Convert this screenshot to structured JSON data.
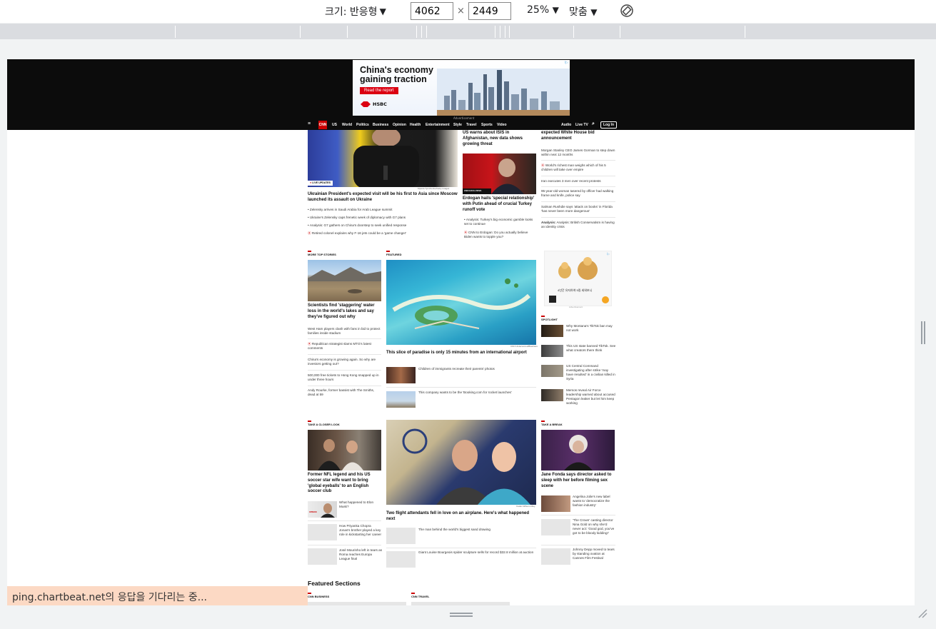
{
  "devtools": {
    "size_label": "크기: 반응형",
    "width_value": "4062",
    "height_value": "2449",
    "times": "×",
    "zoom": "25%",
    "fit": "맞춤",
    "dropdown_glyph": "▼"
  },
  "status": {
    "text": "ping.chartbeat.net의 응답을 기다리는 중..."
  },
  "ad": {
    "headline_1": "China's economy",
    "headline_2": "gaining traction",
    "button": "Read the report",
    "brand": "HSBC",
    "label": "Advertisement",
    "badge": "i▷"
  },
  "nav": {
    "logo": "CNN",
    "items": [
      "US",
      "World",
      "Politics",
      "Business",
      "Opinion",
      "Health",
      "Entertainment",
      "Style",
      "Travel",
      "Sports",
      "Video"
    ],
    "audio": "Audio",
    "live_tv": "Live TV",
    "login": "Log In"
  },
  "lead": {
    "live_badge": "LIVE UPDATES",
    "credit": "Mykola Tymchenko/Getty Images",
    "headline": "Ukrainian President's expected visit will be his first to Asia since Moscow launched its assault on Ukraine",
    "bullets": [
      "Zelensky arrives in Saudi Arabia for Arab League summit",
      "Ukraine's Zelensky caps frenetic week of diplomacy with G7 plans",
      "Analysis: G7 gathers on China's doorstep to seek unified response",
      "Retired colonel explains why F-16 jets could be a 'game changer'"
    ]
  },
  "middle": {
    "isis": "US warns about ISIS in Afghanistan, new data shows growing threat",
    "erdogan_badge": "CNN EXCLUSIVE",
    "erdogan": "Erdogan hails 'special relationship' with Putin ahead of crucial Turkey runoff vote",
    "bullets": [
      "Analysis: Turkey's big economic gamble looks set to continue",
      "CNN to Erdogan: Do you actually believe Biden wants to topple you?"
    ]
  },
  "right_top": {
    "head": "expected White House bid announcement",
    "items": [
      "Morgan Stanley CEO James Gorman to step down within next 12 months",
      "World's richest man weighs which of his 5 children will take over empire",
      "Iran executes 3 men over recent protests",
      "95-year-old woman tasered by officer had walking frame and knife, police say",
      "Salman Rushdie says 'attack on books' in Florida 'has never been more dangerous'",
      "Analysis: British Conservatism is having an identity crisis"
    ]
  },
  "more_top": {
    "label": "MORE TOP STORIES",
    "headline": "Scientists find 'staggering' water loss in the world's lakes and say they've figured out why",
    "items": [
      "West Ham players clash with fans in bid to protect families inside stadium",
      "Republican strategist slams MTG's latest comments",
      "China's economy is growing again. So why are investors getting out?",
      "500,000 free tickets to Hong Kong snapped up in under three hours",
      "Andy Rourke, former bassist with The Smiths, dead at 59"
    ]
  },
  "featured": {
    "label": "FEATURED",
    "credit": "CNN Underscored/Bluehaus",
    "headline": "This slice of paradise is only 15 minutes from an international airport",
    "items": [
      "Children of immigrants recreate their parents' photos",
      "This company wants to be the 'Booking.com for rocket launches'"
    ]
  },
  "side_ad": {
    "text": "4년간 유지하여 5킬 세워보니",
    "label": "Advertisement",
    "badge": "i▷"
  },
  "spotlight": {
    "label": "SPOTLIGHT",
    "items": [
      "Why Montana's TikTok ban may not work",
      "This US state banned TikTok. See what creators there think",
      "US Central Command investigating after strike 'may have resulted' in a civilian killed in Syria",
      "Memos reveal Air Force leadership warned about accused Pentagon leaker but let him keep working"
    ]
  },
  "closer": {
    "label": "TAKE A CLOSER LOOK",
    "headline": "Former NFL legend and his US soccer star wife want to bring 'global eyeballs' to an English soccer club",
    "items": [
      "What happened to Elon Musk?",
      "How Priyanka Chopra Jonas's brother played a key role in kickstarting her career",
      "José Mourinho left in tears as Roma reaches Europa League final"
    ],
    "thumb_badge": "OPINION"
  },
  "mid_feature": {
    "credit": "Caden Wilson-Lilley",
    "headline": "Two flight attendants fell in love on an airplane. Here's what happened next",
    "items": [
      "The man behind the world's biggest sand drawing",
      "Giant Louise Bourgeois spider sculpture sells for record $32.8 million at auction"
    ]
  },
  "break": {
    "label": "TAKE A BREAK",
    "headline": "Jane Fonda says director asked to sleep with her before filming sex scene",
    "items": [
      "Angelina Jolie's new label wants to 'democratize the fashion industry'",
      "'The Crown' casting director Nina Gold on why she'd never act: 'Good god, you've got to be bloody kidding!'",
      "Johnny Depp moved to tears by standing ovation at Cannes Film Festival"
    ]
  },
  "featured_sections": {
    "title": "Featured Sections",
    "labels": [
      "CNN BUSINESS",
      "CNN TRAVEL"
    ]
  }
}
